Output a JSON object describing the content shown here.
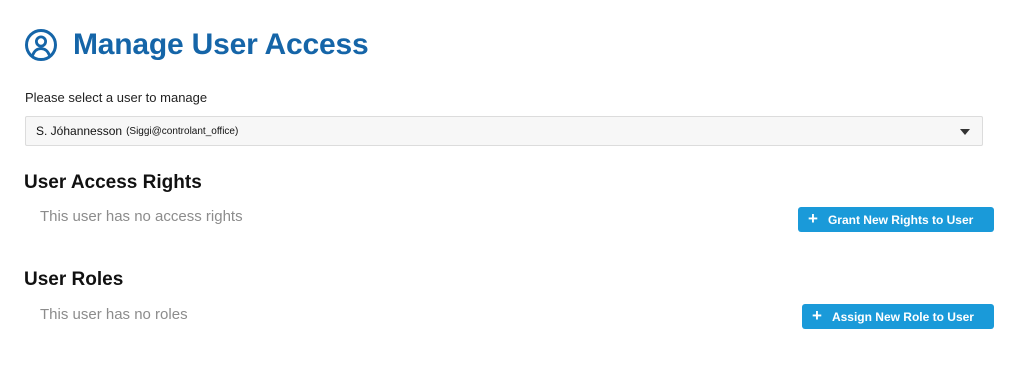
{
  "header": {
    "title": "Manage User Access",
    "icon": "user-circle-icon",
    "accent_color": "#1565a8"
  },
  "user_select": {
    "label": "Please select a user to manage",
    "selected_name": "S. Jóhannesson",
    "selected_login": "(Siggi@controlant_office)"
  },
  "access_rights": {
    "heading": "User Access Rights",
    "empty_text": "This user has no access rights",
    "button_label": "Grant New Rights to User",
    "button_icon": "plus-icon"
  },
  "roles": {
    "heading": "User Roles",
    "empty_text": "This user has no roles",
    "button_label": "Assign New Role to User",
    "button_icon": "plus-icon"
  },
  "colors": {
    "button_bg": "#1a9ad9",
    "muted_text": "#8c8c8c"
  }
}
